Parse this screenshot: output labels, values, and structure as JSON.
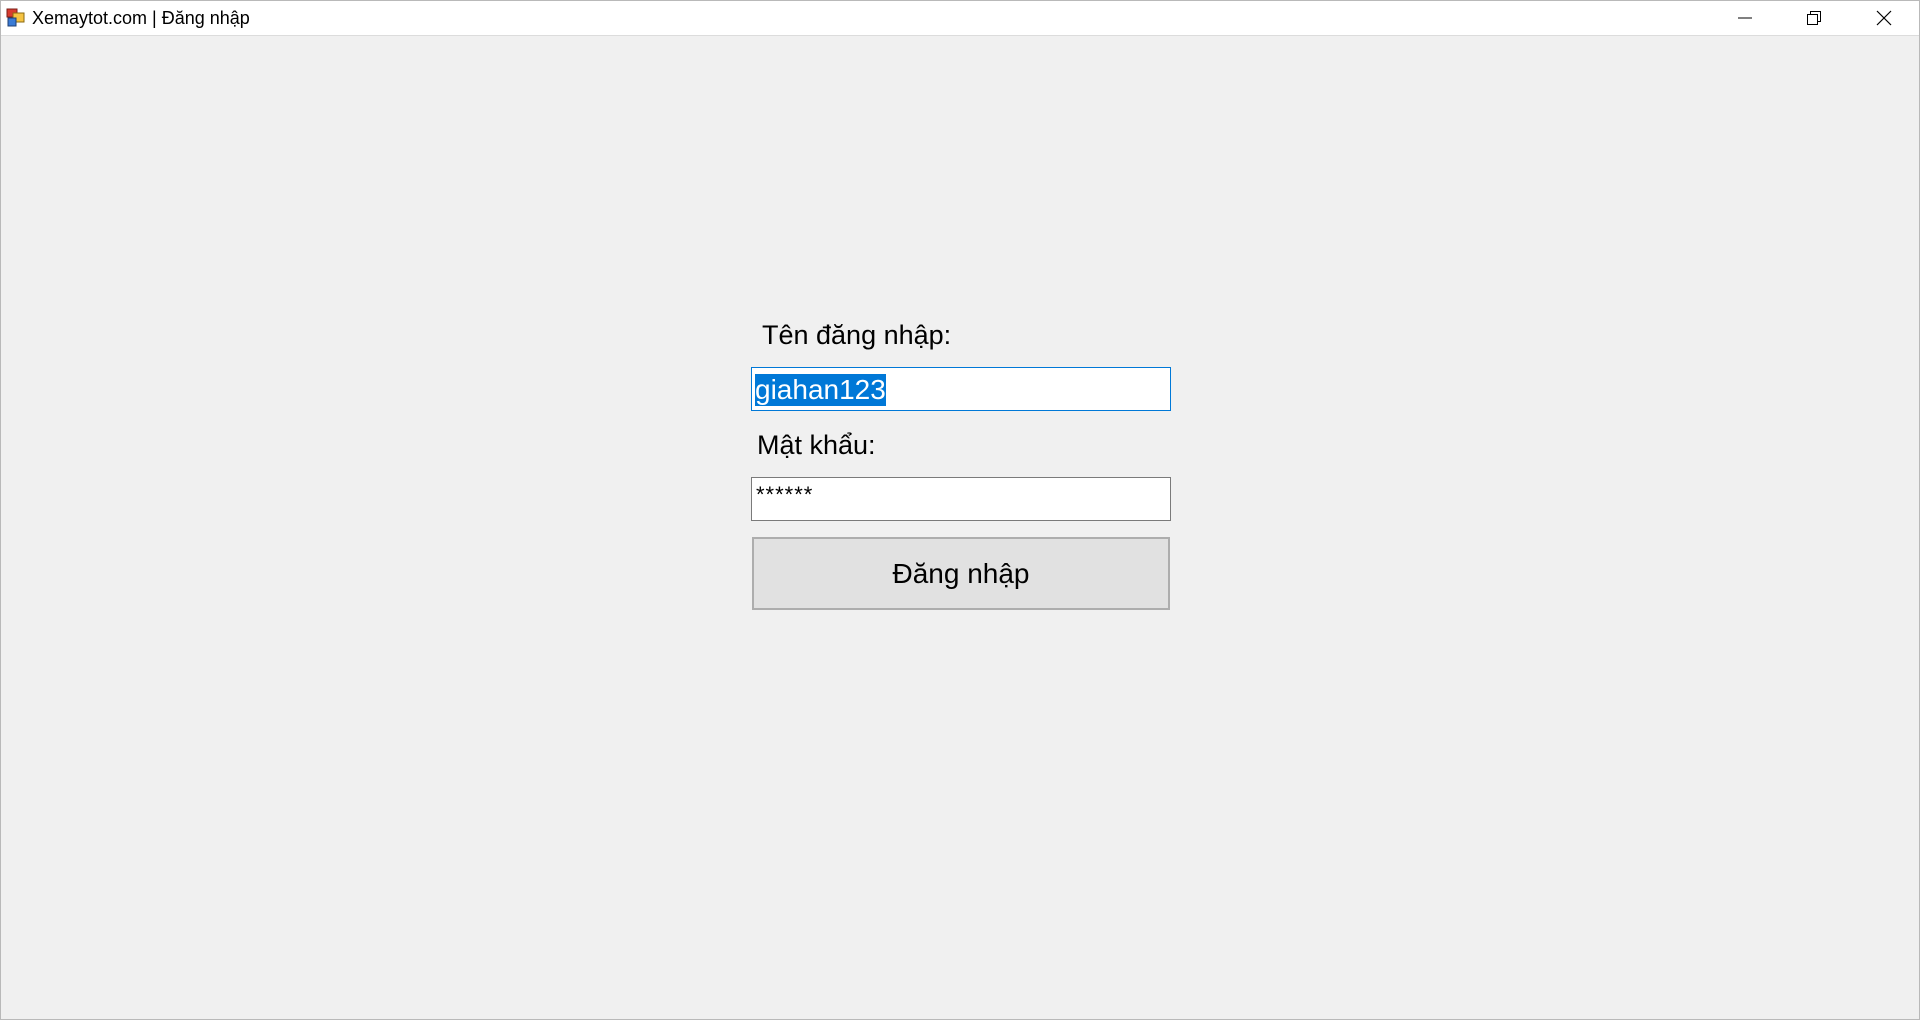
{
  "window": {
    "title": "Xemaytot.com | Đăng nhập",
    "app_icon": "form-app-icon",
    "controls": {
      "minimize_icon": "minimize-icon",
      "maximize_icon": "restore-icon",
      "close_icon": "close-icon"
    }
  },
  "form": {
    "username_label": "Tên đăng nhập:",
    "username_value": "giahan123",
    "password_label": "Mật khẩu:",
    "password_value": "******",
    "login_button_label": "Đăng nhập"
  },
  "colors": {
    "background": "#f0f0f0",
    "selection": "#0078d7",
    "focus_border": "#0078d7",
    "button_face": "#e1e1e1"
  }
}
